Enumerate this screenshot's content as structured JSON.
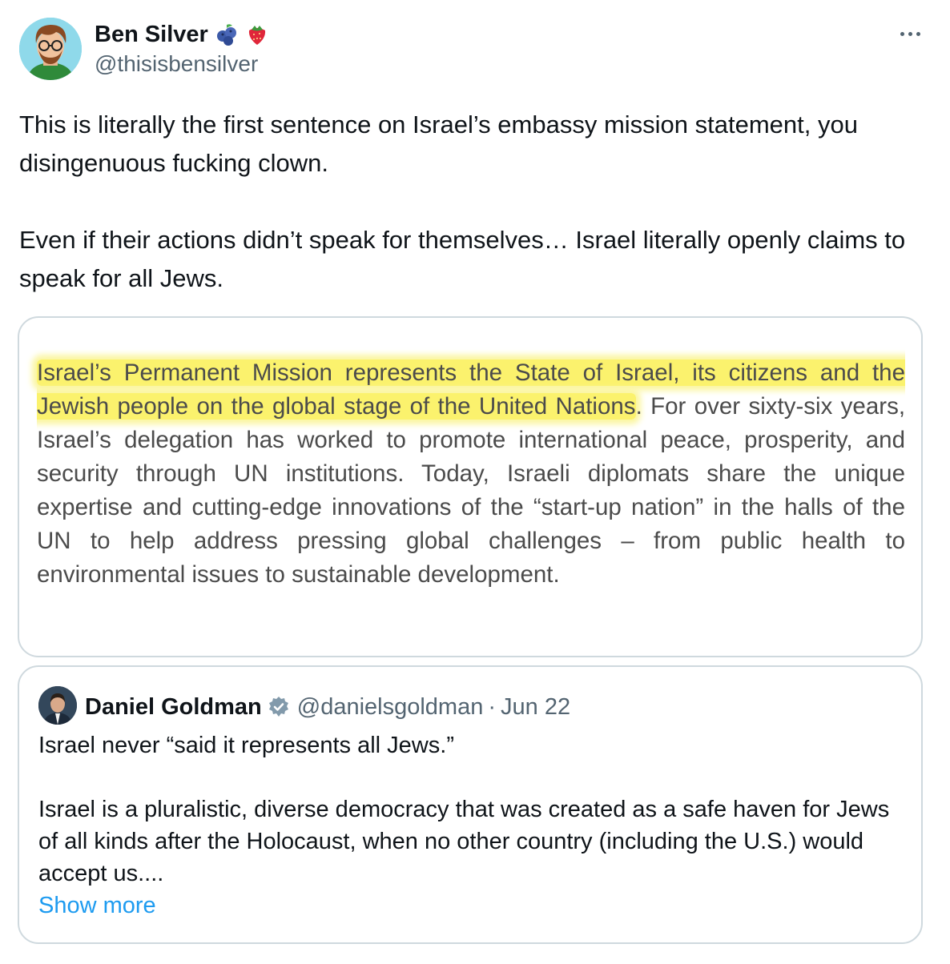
{
  "author": {
    "name": "Ben Silver",
    "handle": "@thisisbensilver",
    "emoji_icons": [
      "blueberries-emoji-icon",
      "strawberry-emoji-icon"
    ]
  },
  "menu_icon": "more-options-icon",
  "tweet": {
    "paragraph1": "This is literally the first sentence on Israel’s embassy mission statement, you disingenuous fucking clown.",
    "paragraph2": "Even if their actions didn’t speak for themselves… Israel literally openly claims to speak for all Jews."
  },
  "media": {
    "highlighted": "Israel’s Permanent Mission represents the State of Israel, its citizens and the Jewish people on the global stage of the United Nations",
    "rest": ". For over sixty-six years, Israel’s delegation has worked to promote international peace, prosperity, and security through UN institutions. Today, Israeli diplomats share the unique expertise and cutting-edge innovations of the “start-up nation” in the halls of the UN to help address pressing global challenges – from public health to environmental issues to sustainable development.",
    "highlight_color": "#fbf26d"
  },
  "quoted": {
    "name": "Daniel Goldman",
    "handle": "@danielsgoldman",
    "separator": "·",
    "date": "Jun 22",
    "verified_icon": "verified-badge-icon",
    "paragraph1": "Israel never “said it represents all Jews.”",
    "paragraph2": "Israel is a pluralistic, diverse democracy that was created as a safe haven for Jews of all kinds after the Holocaust, when no other country (including the U.S.) would accept us....",
    "show_more": "Show more"
  },
  "colors": {
    "link": "#1d9bf0",
    "secondary_text": "#536471",
    "border": "#cfd9de"
  }
}
